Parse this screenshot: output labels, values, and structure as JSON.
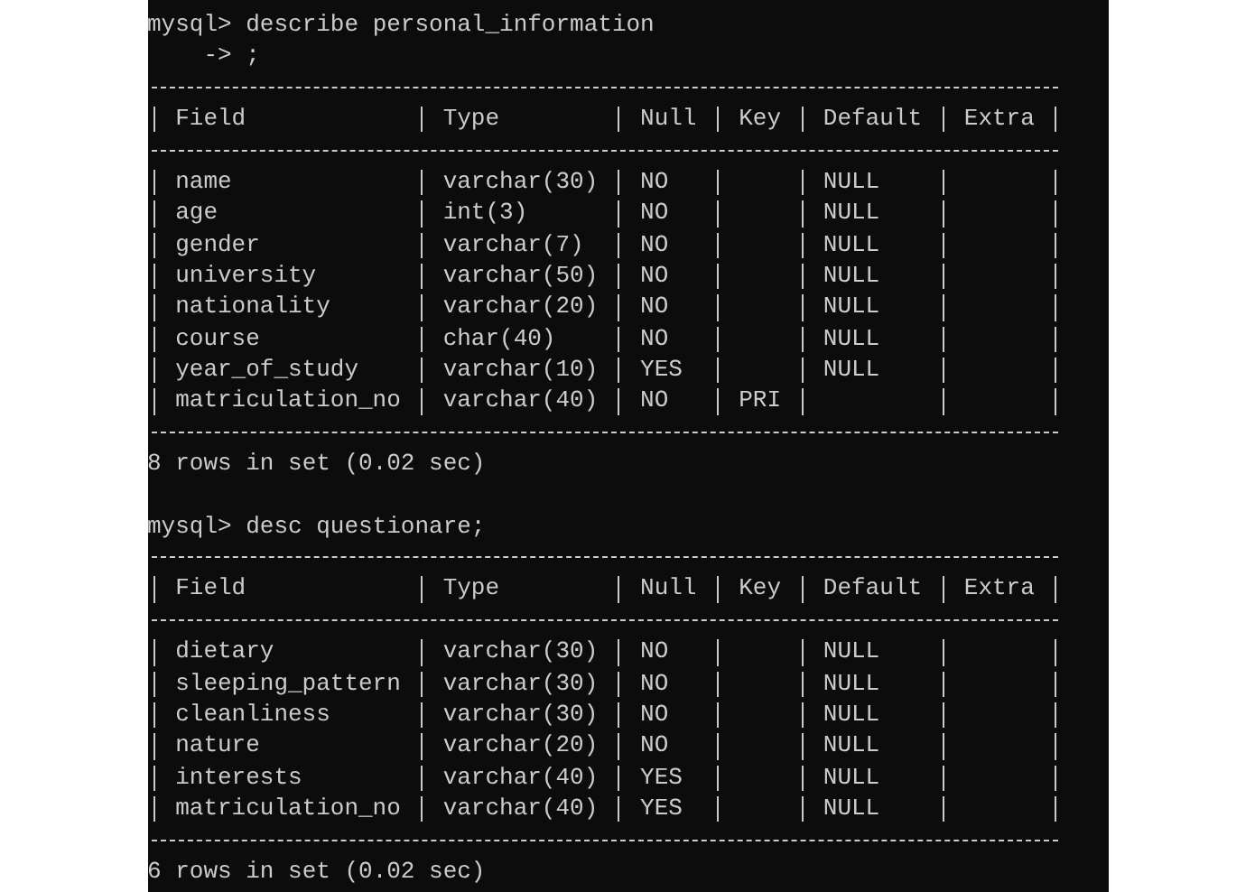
{
  "blocks": [
    {
      "prompt": "mysql> describe personal_information",
      "continuation": "-> ;",
      "columns": [
        "Field",
        "Type",
        "Null",
        "Key",
        "Default",
        "Extra"
      ],
      "rows": [
        {
          "field": "name",
          "type": "varchar(30)",
          "null": "NO",
          "default": "NULL"
        },
        {
          "field": "age",
          "type": "int(3)",
          "null": "NO",
          "default": "NULL"
        },
        {
          "field": "gender",
          "type": "varchar(7)",
          "null": "NO",
          "default": "NULL"
        },
        {
          "field": "university",
          "type": "varchar(50)",
          "null": "NO",
          "default": "NULL"
        },
        {
          "field": "nationality",
          "type": "varchar(20)",
          "null": "NO",
          "default": "NULL"
        },
        {
          "field": "course",
          "type": "char(40)",
          "null": "NO",
          "default": "NULL"
        },
        {
          "field": "year_of_study",
          "type": "varchar(10)",
          "null": "YES",
          "default": "NULL"
        },
        {
          "field": "matriculation_no",
          "type": "varchar(40)",
          "null": "NO",
          "key": "PRI"
        }
      ],
      "summary": "8 rows in set (0.02 sec)"
    },
    {
      "prompt": "mysql> desc questionare;",
      "columns": [
        "Field",
        "Type",
        "Null",
        "Key",
        "Default",
        "Extra"
      ],
      "rows": [
        {
          "field": "dietary",
          "type": "varchar(30)",
          "null": "NO",
          "default": "NULL"
        },
        {
          "field": "sleeping_pattern",
          "type": "varchar(30)",
          "null": "NO",
          "default": "NULL"
        },
        {
          "field": "cleanliness",
          "type": "varchar(30)",
          "null": "NO",
          "default": "NULL"
        },
        {
          "field": "nature",
          "type": "varchar(20)",
          "null": "NO",
          "default": "NULL"
        },
        {
          "field": "interests",
          "type": "varchar(40)",
          "null": "YES",
          "default": "NULL"
        },
        {
          "field": "matriculation_no",
          "type": "varchar(40)",
          "null": "YES",
          "default": "NULL"
        }
      ],
      "summary": "6 rows in set (0.02 sec)"
    }
  ]
}
